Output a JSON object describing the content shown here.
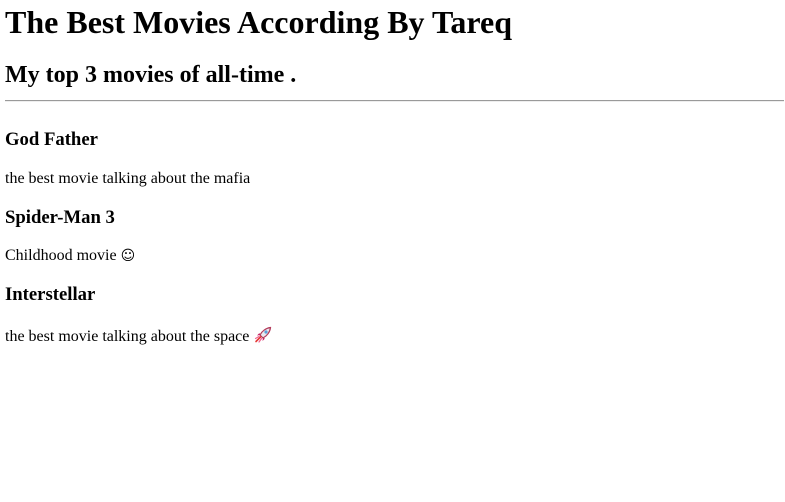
{
  "page": {
    "title": "The Best Movies According By Tareq",
    "subtitle": "My top 3 movies of all-time ."
  },
  "movies": [
    {
      "title": "God Father",
      "description": "the best movie talking about the mafia"
    },
    {
      "title": "Spider-Man 3",
      "description": "Childhood movie",
      "emoji": "☺"
    },
    {
      "title": "Interstellar",
      "description": "the best movie talking about the space",
      "icon": "rocket-icon"
    }
  ]
}
